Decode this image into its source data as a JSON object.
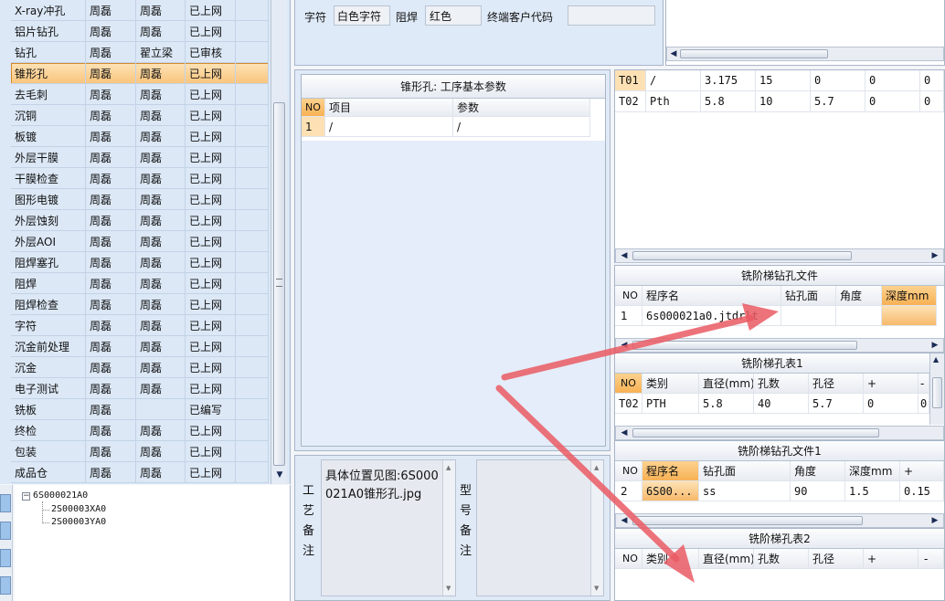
{
  "process_list": {
    "rows": [
      {
        "name": "X-ray冲孔",
        "op1": "周磊",
        "op2": "周磊",
        "status": "已上网"
      },
      {
        "name": "铝片钻孔",
        "op1": "周磊",
        "op2": "周磊",
        "status": "已上网"
      },
      {
        "name": "钻孔",
        "op1": "周磊",
        "op2": "翟立梁",
        "status": "已审核"
      },
      {
        "name": "锥形孔",
        "op1": "周磊",
        "op2": "周磊",
        "status": "已上网"
      },
      {
        "name": "去毛刺",
        "op1": "周磊",
        "op2": "周磊",
        "status": "已上网"
      },
      {
        "name": "沉铜",
        "op1": "周磊",
        "op2": "周磊",
        "status": "已上网"
      },
      {
        "name": "板镀",
        "op1": "周磊",
        "op2": "周磊",
        "status": "已上网"
      },
      {
        "name": "外层干膜",
        "op1": "周磊",
        "op2": "周磊",
        "status": "已上网"
      },
      {
        "name": "干膜检查",
        "op1": "周磊",
        "op2": "周磊",
        "status": "已上网"
      },
      {
        "name": "图形电镀",
        "op1": "周磊",
        "op2": "周磊",
        "status": "已上网"
      },
      {
        "name": "外层蚀刻",
        "op1": "周磊",
        "op2": "周磊",
        "status": "已上网"
      },
      {
        "name": "外层AOI",
        "op1": "周磊",
        "op2": "周磊",
        "status": "已上网"
      },
      {
        "name": "阻焊塞孔",
        "op1": "周磊",
        "op2": "周磊",
        "status": "已上网"
      },
      {
        "name": "阻焊",
        "op1": "周磊",
        "op2": "周磊",
        "status": "已上网"
      },
      {
        "name": "阻焊检查",
        "op1": "周磊",
        "op2": "周磊",
        "status": "已上网"
      },
      {
        "name": "字符",
        "op1": "周磊",
        "op2": "周磊",
        "status": "已上网"
      },
      {
        "name": "沉金前处理",
        "op1": "周磊",
        "op2": "周磊",
        "status": "已上网"
      },
      {
        "name": "沉金",
        "op1": "周磊",
        "op2": "周磊",
        "status": "已上网"
      },
      {
        "name": "电子测试",
        "op1": "周磊",
        "op2": "周磊",
        "status": "已上网"
      },
      {
        "name": "铣板",
        "op1": "周磊",
        "op2": "",
        "status": "已编写"
      },
      {
        "name": "终检",
        "op1": "周磊",
        "op2": "周磊",
        "status": "已上网"
      },
      {
        "name": "包装",
        "op1": "周磊",
        "op2": "周磊",
        "status": "已上网"
      },
      {
        "name": "成品仓",
        "op1": "周磊",
        "op2": "周磊",
        "status": "已上网"
      }
    ],
    "selected_index": 3
  },
  "tree": {
    "root": "6S000021A0",
    "children": [
      "2S00003XA0",
      "2S00003YA0"
    ]
  },
  "top_form": {
    "char_label": "字符",
    "char_value": "白色字符",
    "mask_label": "阻焊",
    "mask_value": "红色",
    "customer_code_label": "终端客户代码",
    "customer_code_value": ""
  },
  "params_panel": {
    "title": "锥形孔: 工序基本参数",
    "headers": [
      "NO",
      "项目",
      "参数"
    ],
    "rows": [
      [
        "1",
        "/",
        "/"
      ]
    ]
  },
  "notes": {
    "process_label": "工艺备注",
    "process_text": "具体位置见图:6S000021A0锥形孔.jpg",
    "model_label": "型号备注",
    "model_text": ""
  },
  "tool_table": {
    "rows": [
      [
        "T01",
        "/",
        "3.175",
        "15",
        "0",
        "0",
        "0"
      ],
      [
        "T02",
        "Pth",
        "5.8",
        "10",
        "5.7",
        "0",
        "0"
      ]
    ]
  },
  "step_drill_file": {
    "title": "铣阶梯钻孔文件",
    "headers": [
      "NO",
      "程序名",
      "钻孔面",
      "角度",
      "深度mm"
    ],
    "rows": [
      [
        "1",
        "6s000021a0.jtdrlt",
        "",
        "",
        ""
      ]
    ]
  },
  "step_hole_table1": {
    "title": "铣阶梯孔表1",
    "headers": [
      "NO",
      "类别",
      "直径(mm)",
      "孔数",
      "孔径",
      "+",
      "-"
    ],
    "rows": [
      [
        "T02",
        "PTH",
        "5.8",
        "40",
        "5.7",
        "0",
        "0"
      ]
    ]
  },
  "step_drill_file1": {
    "title": "铣阶梯钻孔文件1",
    "headers": [
      "NO",
      "程序名",
      "钻孔面",
      "角度",
      "深度mm",
      "+"
    ],
    "rows": [
      [
        "2",
        "6S00...",
        "ss",
        "90",
        "1.5",
        "0.15"
      ]
    ]
  },
  "step_hole_table2": {
    "title": "铣阶梯孔表2",
    "headers": [
      "NO",
      "类别",
      "直径(mm)",
      "孔数",
      "孔径",
      "+",
      "-"
    ]
  },
  "colors": {
    "accent_orange": "#f9c26e",
    "selected_row": "#fbd7a0",
    "annotation_arrow": "#ea5a64",
    "panel_bg": "#dfeaf8"
  }
}
